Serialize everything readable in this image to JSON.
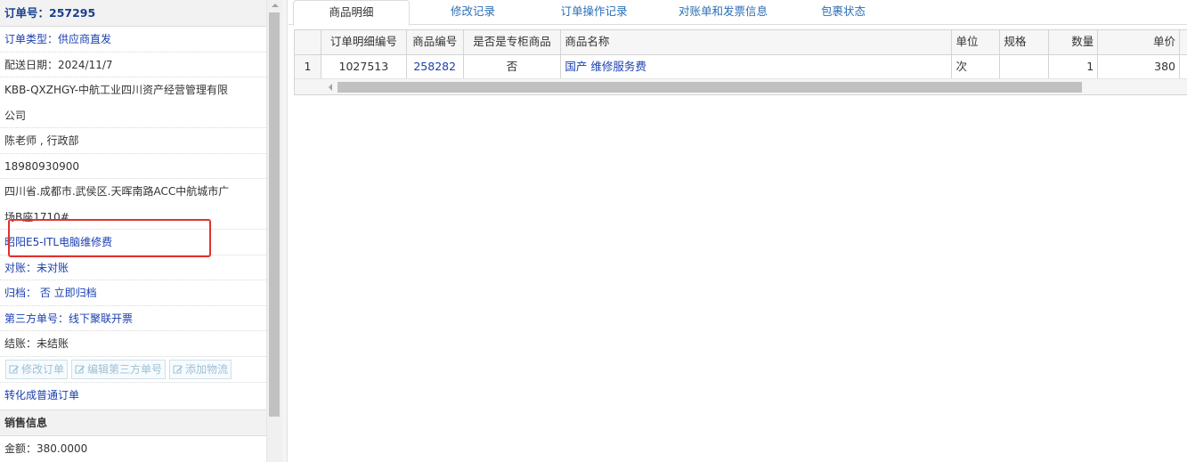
{
  "order": {
    "title": "订单号：257295",
    "rows": [
      {
        "text": "订单类型：供应商直发",
        "style": "link"
      },
      {
        "text": "配送日期：2024/11/7",
        "style": "plain"
      },
      {
        "text": "KBB-QXZHGY-中航工业四川资产经营管理有限",
        "style": "plain"
      },
      {
        "text": "公司",
        "style": "plain"
      },
      {
        "text": "陈老师 , 行政部",
        "style": "plain"
      },
      {
        "text": "18980930900",
        "style": "plain"
      },
      {
        "text": "四川省.成都市.武侯区.天晖南路ACC中航城市广",
        "style": "plain"
      },
      {
        "text": "场B座1710#",
        "style": "plain"
      },
      {
        "text": "昭阳E5-ITL电脑维修费",
        "style": "link"
      },
      {
        "text": "对账：未对账",
        "style": "link"
      },
      {
        "text": "归档： 否 立即归档",
        "style": "link"
      },
      {
        "text": "第三方单号：线下聚联开票",
        "style": "link"
      },
      {
        "text": "结账：未结账",
        "style": "plain"
      }
    ],
    "buttons": [
      "修改订单",
      "编辑第三方单号",
      "添加物流"
    ],
    "convert_link": "转化成普通订单"
  },
  "sales": {
    "title": "销售信息",
    "amount": "金额：380.0000"
  },
  "tabs": [
    {
      "label": "商品明细",
      "active": true
    },
    {
      "label": "修改记录",
      "active": false
    },
    {
      "label": "订单操作记录",
      "active": false
    },
    {
      "label": "对账单和发票信息",
      "active": false
    },
    {
      "label": "包裹状态",
      "active": false
    }
  ],
  "grid": {
    "columns": [
      "",
      "订单明细编号",
      "商品编号",
      "是否是专柜商品",
      "商品名称",
      "单位",
      "规格",
      "数量",
      "单价"
    ],
    "rows": [
      [
        "1",
        "1027513",
        "258282",
        "否",
        "国产 维修服务费",
        "次",
        "",
        "1",
        "380"
      ]
    ]
  },
  "colors": {
    "link": "#1a3fb0",
    "highlight": "#e0322d",
    "tab": "#2b6fb6"
  }
}
